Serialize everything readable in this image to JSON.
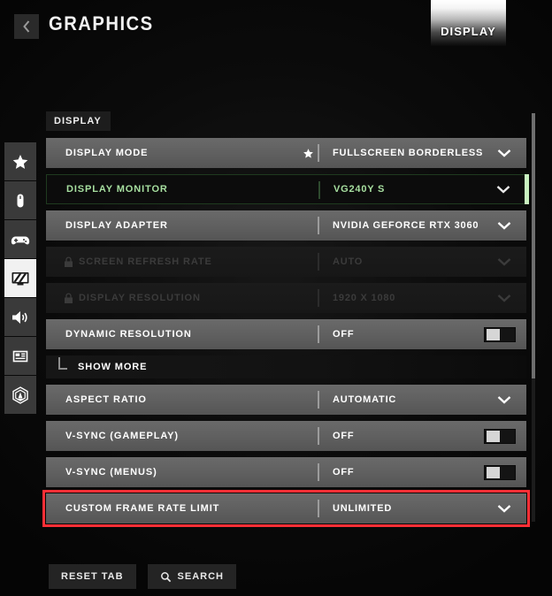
{
  "header": {
    "back_icon": "chevron-left-icon",
    "title": "GRAPHICS",
    "tab_label": "DISPLAY"
  },
  "sidebar": {
    "items": [
      {
        "icon": "star-icon",
        "name": "favorites",
        "active": false
      },
      {
        "icon": "mouse-icon",
        "name": "mouse-keyboard",
        "active": false
      },
      {
        "icon": "gamepad-icon",
        "name": "controller",
        "active": false
      },
      {
        "icon": "monitor-icon",
        "name": "graphics",
        "active": true
      },
      {
        "icon": "speaker-icon",
        "name": "audio",
        "active": false
      },
      {
        "icon": "interface-icon",
        "name": "interface",
        "active": false
      },
      {
        "icon": "telemetry-icon",
        "name": "telemetry",
        "active": false
      }
    ]
  },
  "panel": {
    "section_label": "DISPLAY",
    "rows": [
      {
        "label": "DISPLAY MODE",
        "value": "FULLSCREEN BORDERLESS",
        "control": "dropdown",
        "state": "normal",
        "favorited": true,
        "locked": false
      },
      {
        "label": "DISPLAY MONITOR",
        "value": "VG240Y S",
        "control": "dropdown",
        "state": "selected",
        "favorited": false,
        "locked": false
      },
      {
        "label": "DISPLAY ADAPTER",
        "value": "NVIDIA GEFORCE RTX 3060",
        "control": "dropdown",
        "state": "normal",
        "favorited": false,
        "locked": false
      },
      {
        "label": "SCREEN REFRESH RATE",
        "value": "AUTO",
        "control": "dropdown",
        "state": "disabled",
        "favorited": false,
        "locked": true
      },
      {
        "label": "DISPLAY RESOLUTION",
        "value": "1920 X 1080",
        "control": "dropdown",
        "state": "disabled",
        "favorited": false,
        "locked": true
      },
      {
        "label": "DYNAMIC RESOLUTION",
        "value": "OFF",
        "control": "toggle",
        "state": "normal",
        "favorited": false,
        "locked": false
      }
    ],
    "sub_row": {
      "label": "SHOW MORE"
    },
    "rows_after": [
      {
        "label": "ASPECT RATIO",
        "value": "AUTOMATIC",
        "control": "dropdown",
        "state": "normal",
        "favorited": false,
        "locked": false
      },
      {
        "label": "V-SYNC (GAMEPLAY)",
        "value": "OFF",
        "control": "toggle",
        "state": "normal",
        "favorited": false,
        "locked": false
      },
      {
        "label": "V-SYNC (MENUS)",
        "value": "OFF",
        "control": "toggle",
        "state": "normal",
        "favorited": false,
        "locked": false
      },
      {
        "label": "CUSTOM FRAME RATE LIMIT",
        "value": "UNLIMITED",
        "control": "dropdown",
        "state": "flagged",
        "favorited": false,
        "locked": false
      }
    ]
  },
  "footer": {
    "reset_label": "RESET TAB",
    "search_label": "SEARCH",
    "search_icon": "magnifier-icon"
  },
  "colors": {
    "accent_green": "#c9f2c0",
    "highlight_red": "#ff2f36",
    "row_base": "#606060",
    "panel_bg": "#0b0b0b"
  }
}
